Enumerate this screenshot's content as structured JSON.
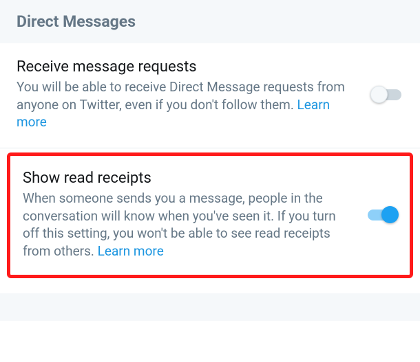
{
  "header": {
    "title": "Direct Messages"
  },
  "settings": [
    {
      "title": "Receive message requests",
      "description": "You will be able to receive Direct Message requests from anyone on Twitter, even if you don't follow them.",
      "learn_more": "Learn more",
      "enabled": false,
      "highlighted": false
    },
    {
      "title": "Show read receipts",
      "description": "When someone sends you a message, people in the conversation will know when you've seen it. If you turn off this setting, you won't be able to see read receipts from others.",
      "learn_more": "Learn more",
      "enabled": true,
      "highlighted": true
    }
  ],
  "colors": {
    "header_bg": "#f5f8fa",
    "header_text": "#657786",
    "title_text": "#14171a",
    "desc_text": "#657786",
    "link": "#1b95e0",
    "toggle_on": "#1da1f2",
    "toggle_on_track": "#8ed0f9",
    "toggle_off_track": "#ccd6dd",
    "highlight_border": "#ff1a1a"
  }
}
